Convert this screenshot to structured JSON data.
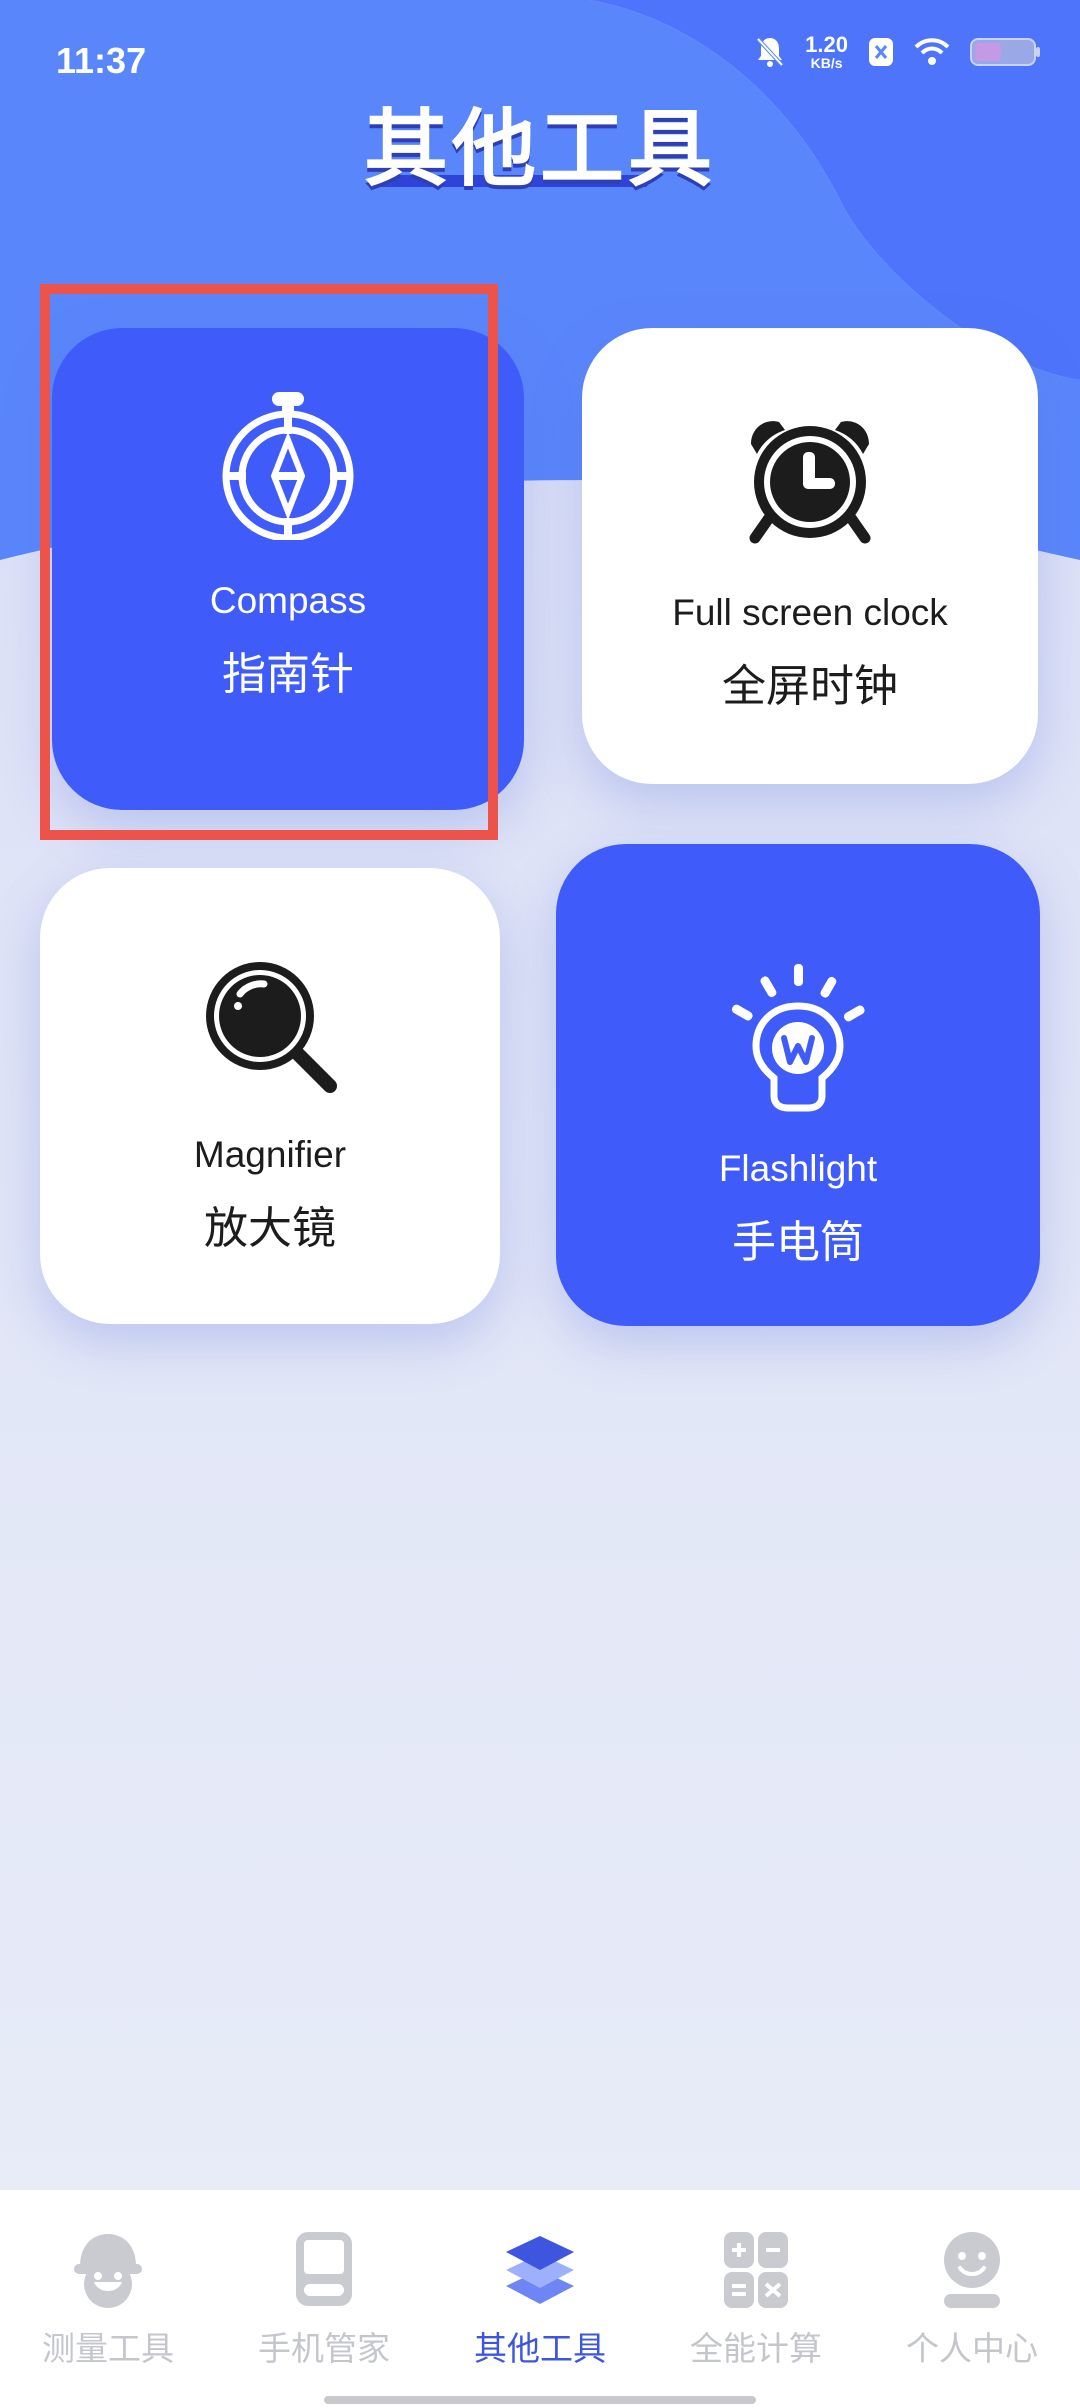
{
  "status_bar": {
    "time": "11:37",
    "net_speed_value": "1.20",
    "net_speed_unit": "KB/s"
  },
  "page": {
    "title": "其他工具"
  },
  "tools": [
    {
      "name_en": "Compass",
      "name_zh": "指南针",
      "icon": "compass-icon"
    },
    {
      "name_en": "Full screen clock",
      "name_zh": "全屏时钟",
      "icon": "alarm-clock-icon"
    },
    {
      "name_en": "Magnifier",
      "name_zh": "放大镜",
      "icon": "magnifier-icon"
    },
    {
      "name_en": "Flashlight",
      "name_zh": "手电筒",
      "icon": "lightbulb-icon"
    }
  ],
  "tabs": [
    {
      "label": "测量工具",
      "icon": "measure-robot-icon",
      "active": false
    },
    {
      "label": "手机管家",
      "icon": "phone-manager-icon",
      "active": false
    },
    {
      "label": "其他工具",
      "icon": "layers-icon",
      "active": true
    },
    {
      "label": "全能计算",
      "icon": "calculator-icon",
      "active": false
    },
    {
      "label": "个人中心",
      "icon": "profile-icon",
      "active": false
    }
  ],
  "colors": {
    "primary_blue": "#3f5cfa",
    "header_blue": "#5a86fb",
    "active_tab": "#3e55e0",
    "inactive_tab": "#c4c6cc",
    "highlight": "#ec534b"
  }
}
